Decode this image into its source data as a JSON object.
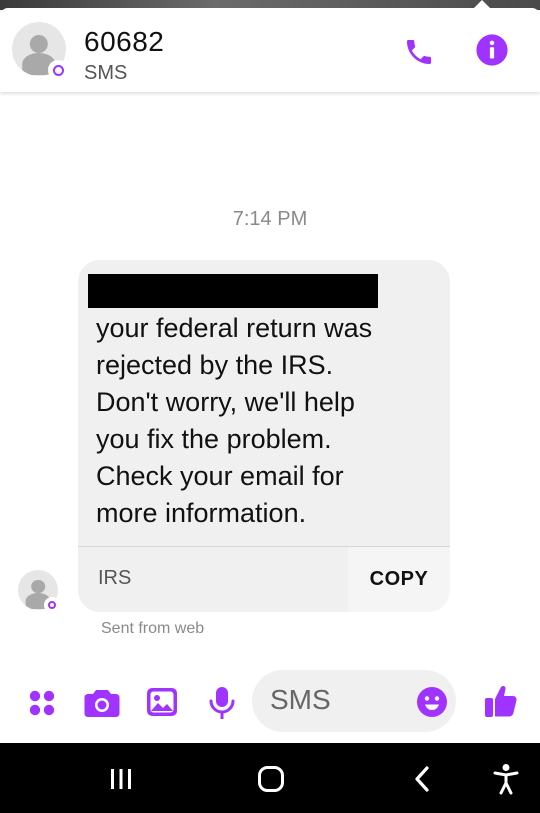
{
  "header": {
    "contact_name": "60682",
    "contact_subtitle": "SMS"
  },
  "thread": {
    "timestamp": "7:14 PM",
    "message_lines": [
      "your federal return was",
      "rejected by the IRS.",
      "Don't worry, we'll help",
      "you fix the problem.",
      "Check your email for",
      "more information."
    ],
    "link_source": "IRS",
    "copy_label": "COPY",
    "sent_note": "Sent from web"
  },
  "composer": {
    "placeholder": "SMS"
  },
  "icons": {
    "call": "phone-icon",
    "info": "info-icon",
    "apps": "apps-grid-icon",
    "camera": "camera-icon",
    "gallery": "gallery-icon",
    "mic": "microphone-icon",
    "emoji": "emoji-icon",
    "like": "thumbs-up-icon",
    "recents": "recents-icon",
    "home": "home-icon",
    "back": "back-icon",
    "accessibility": "accessibility-icon"
  },
  "colors": {
    "accent": "#a033ff",
    "bubble": "#f0f0f0",
    "navbar": "#000000"
  }
}
